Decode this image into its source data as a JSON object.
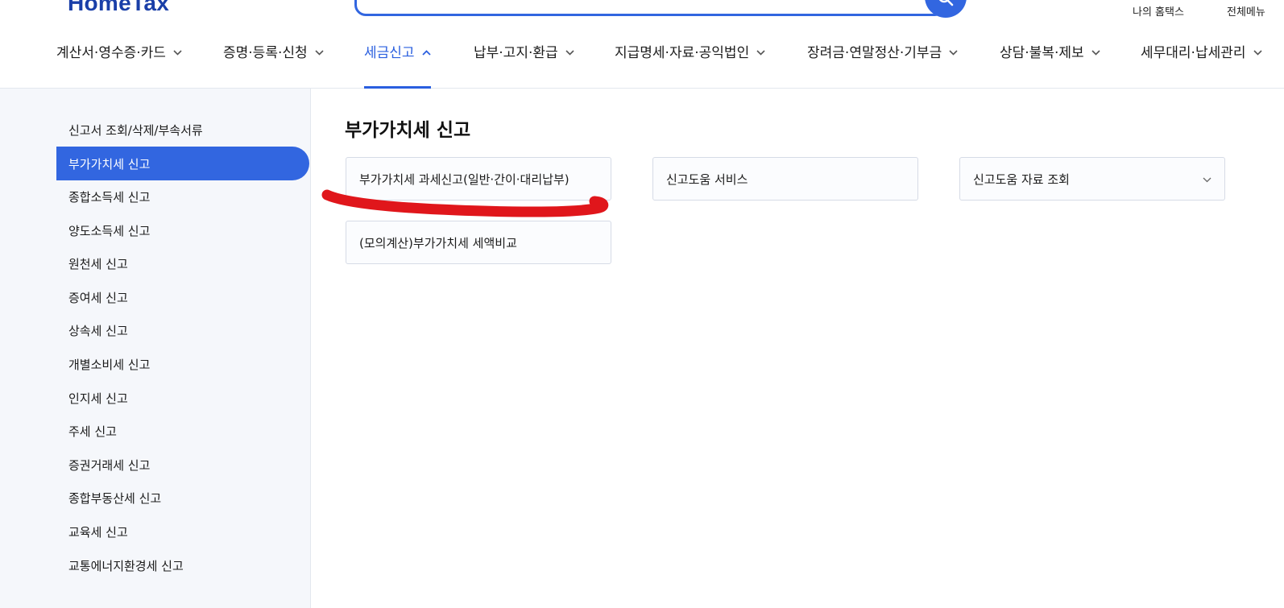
{
  "header": {
    "logo": "HomeTax",
    "util_links": [
      "나의 홈택스",
      "전체메뉴"
    ]
  },
  "gnb": {
    "items": [
      {
        "label": "계산서·영수증·카드",
        "active": false
      },
      {
        "label": "증명·등록·신청",
        "active": false
      },
      {
        "label": "세금신고",
        "active": true
      },
      {
        "label": "납부·고지·환급",
        "active": false
      },
      {
        "label": "지급명세·자료·공익법인",
        "active": false
      },
      {
        "label": "장려금·연말정산·기부금",
        "active": false
      },
      {
        "label": "상담·불복·제보",
        "active": false
      },
      {
        "label": "세무대리·납세관리",
        "active": false
      }
    ]
  },
  "sidebar": {
    "items": [
      {
        "label": "신고서 조회/삭제/부속서류"
      },
      {
        "label": "부가가치세 신고",
        "active": true
      },
      {
        "label": "종합소득세 신고"
      },
      {
        "label": "양도소득세 신고"
      },
      {
        "label": "원천세 신고"
      },
      {
        "label": "증여세 신고"
      },
      {
        "label": "상속세 신고"
      },
      {
        "label": "개별소비세 신고"
      },
      {
        "label": "인지세 신고"
      },
      {
        "label": "주세 신고"
      },
      {
        "label": "증권거래세 신고"
      },
      {
        "label": "종합부동산세 신고"
      },
      {
        "label": "교육세 신고"
      },
      {
        "label": "교통에너지환경세 신고"
      }
    ]
  },
  "main": {
    "title": "부가가치세 신고",
    "cards": [
      {
        "label": "부가가치세 과세신고(일반·간이·대리납부)"
      },
      {
        "label": "신고도움 서비스"
      },
      {
        "label": "신고도움 자료 조회",
        "dropdown": true
      },
      {
        "label": "(모의계산)부가가치세 세액비교"
      }
    ]
  },
  "colors": {
    "accent": "#3266e0",
    "active_text": "#2a5fdf",
    "highlight_stroke": "#e0161b",
    "sidebar_bg": "#f5f7fb"
  },
  "icons": {
    "search": "search-icon",
    "chevron": "chevron-down-icon",
    "chevron_up": "chevron-up-icon"
  }
}
